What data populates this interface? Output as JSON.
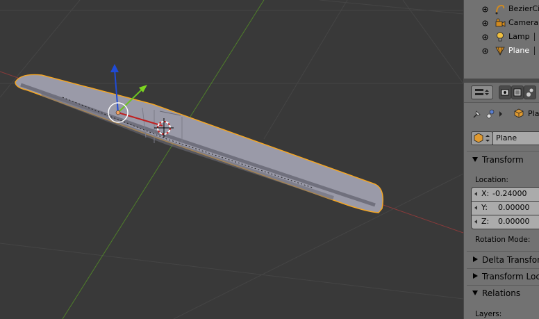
{
  "outliner": {
    "items": [
      {
        "label": "BezierCir",
        "icon": "curve-icon"
      },
      {
        "label": "Camera",
        "icon": "camera-icon"
      },
      {
        "label": "Lamp",
        "icon": "lamp-icon"
      },
      {
        "label": "Plane",
        "icon": "mesh-icon",
        "selected": true
      }
    ]
  },
  "properties": {
    "breadcrumb": "Pla",
    "object_name": "Plane",
    "transform": {
      "title": "Transform",
      "location_label": "Location:",
      "x_label": "X:",
      "x_value": "-0.24000",
      "y_label": "Y:",
      "y_value": "0.00000",
      "z_label": "Z:",
      "z_value": "0.00000",
      "rotation_mode_label": "Rotation Mode:"
    },
    "delta_transform": "Delta Transform",
    "transform_locks": "Transform Locks",
    "relations": "Relations",
    "layers_label": "Layers:"
  },
  "colors": {
    "viewport_bg": "#393939",
    "selection_outline": "#f5a623",
    "x_axis": "#9b3a3a",
    "y_axis": "#5a8a2a",
    "z_manipulator": "#1f4bd6",
    "y_manipulator": "#7cd420",
    "panel_bg": "#727272"
  }
}
